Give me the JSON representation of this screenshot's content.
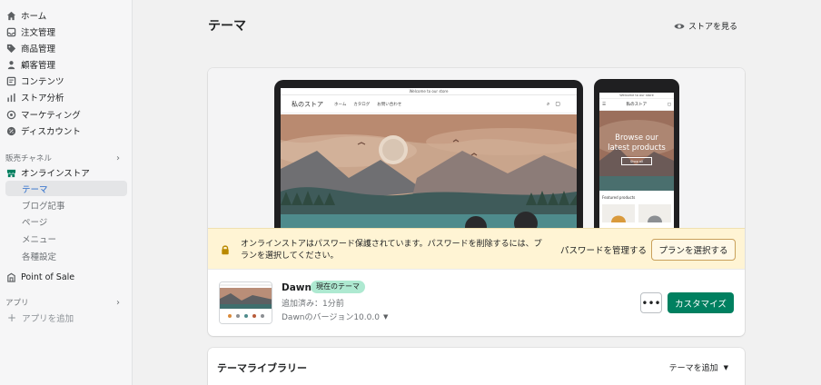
{
  "sidebar": {
    "main_items": [
      {
        "label": "ホーム",
        "icon": "home-icon"
      },
      {
        "label": "注文管理",
        "icon": "orders-icon"
      },
      {
        "label": "商品管理",
        "icon": "tag-icon"
      },
      {
        "label": "顧客管理",
        "icon": "person-icon"
      },
      {
        "label": "コンテンツ",
        "icon": "content-icon"
      },
      {
        "label": "ストア分析",
        "icon": "analytics-icon"
      },
      {
        "label": "マーケティング",
        "icon": "marketing-icon"
      },
      {
        "label": "ディスカウント",
        "icon": "discount-icon"
      }
    ],
    "sales_channels_label": "販売チャネル",
    "online_store_label": "オンラインストア",
    "online_store_sub": [
      {
        "label": "テーマ",
        "active": true
      },
      {
        "label": "ブログ記事",
        "active": false
      },
      {
        "label": "ページ",
        "active": false
      },
      {
        "label": "メニュー",
        "active": false
      },
      {
        "label": "各種設定",
        "active": false
      }
    ],
    "pos_label": "Point of Sale",
    "apps_label": "アプリ",
    "add_app_label": "アプリを追加"
  },
  "header": {
    "title": "テーマ",
    "view_store": "ストアを見る"
  },
  "preview": {
    "desktop_announcement": "Welcome to our store",
    "desktop_store_name": "私のストア",
    "desktop_menu": [
      "ホーム",
      "カタログ",
      "お問い合わせ"
    ],
    "mobile_announcement": "Welcome to our store",
    "mobile_store_name": "私のストア",
    "mobile_hero_line1": "Browse our",
    "mobile_hero_line2": "latest products",
    "mobile_shop_button": "Shop all",
    "mobile_featured": "Featured products"
  },
  "banner": {
    "text": "オンラインストアはパスワード保護されています。パスワードを削除するには、プランを選択してください。",
    "manage_password": "パスワードを管理する",
    "choose_plan": "プランを選択する"
  },
  "current_theme": {
    "name": "Dawn",
    "badge": "現在のテーマ",
    "added": "追加済み：1分前",
    "version": "Dawnのバージョン10.0.0",
    "more": "•••",
    "customize": "カスタマイズ"
  },
  "library": {
    "title": "テーマライブラリー",
    "add_theme": "テーマを追加"
  },
  "colors": {
    "accent_green": "#008060",
    "badge_green": "#aee9d1",
    "banner_bg": "#fff4d4",
    "active_nav": "#2c6ecb"
  }
}
